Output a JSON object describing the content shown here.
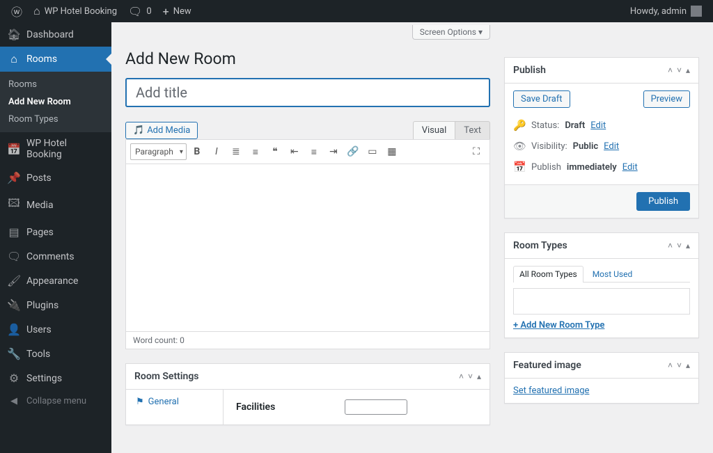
{
  "admin_bar": {
    "site_name": "WP Hotel Booking",
    "comments_count": "0",
    "new_label": "New",
    "howdy": "Howdy, admin"
  },
  "screen_options_label": "Screen Options ▾",
  "page_title": "Add New Room",
  "title_placeholder": "Add title",
  "sidebar": {
    "items": [
      {
        "label": "Dashboard"
      },
      {
        "label": "Rooms"
      },
      {
        "label": "WP Hotel Booking"
      },
      {
        "label": "Posts"
      },
      {
        "label": "Media"
      },
      {
        "label": "Pages"
      },
      {
        "label": "Comments"
      },
      {
        "label": "Appearance"
      },
      {
        "label": "Plugins"
      },
      {
        "label": "Users"
      },
      {
        "label": "Tools"
      },
      {
        "label": "Settings"
      }
    ],
    "submenu": [
      {
        "label": "Rooms"
      },
      {
        "label": "Add New Room"
      },
      {
        "label": "Room Types"
      }
    ],
    "collapse_label": "Collapse menu"
  },
  "editor": {
    "add_media_label": "Add Media",
    "tab_visual": "Visual",
    "tab_text": "Text",
    "format_label": "Paragraph",
    "word_count_label": "Word count: 0"
  },
  "publish": {
    "title": "Publish",
    "save_draft": "Save Draft",
    "preview": "Preview",
    "status_label": "Status:",
    "status_value": "Draft",
    "visibility_label": "Visibility:",
    "visibility_value": "Public",
    "schedule_label": "Publish",
    "schedule_value": "immediately",
    "edit": "Edit",
    "publish_btn": "Publish"
  },
  "room_types": {
    "title": "Room Types",
    "tab_all": "All Room Types",
    "tab_most": "Most Used",
    "add_new": "+ Add New Room Type"
  },
  "featured": {
    "title": "Featured image",
    "set_link": "Set featured image"
  },
  "room_settings": {
    "title": "Room Settings",
    "tab_general": "General",
    "field_facilities": "Facilities"
  }
}
